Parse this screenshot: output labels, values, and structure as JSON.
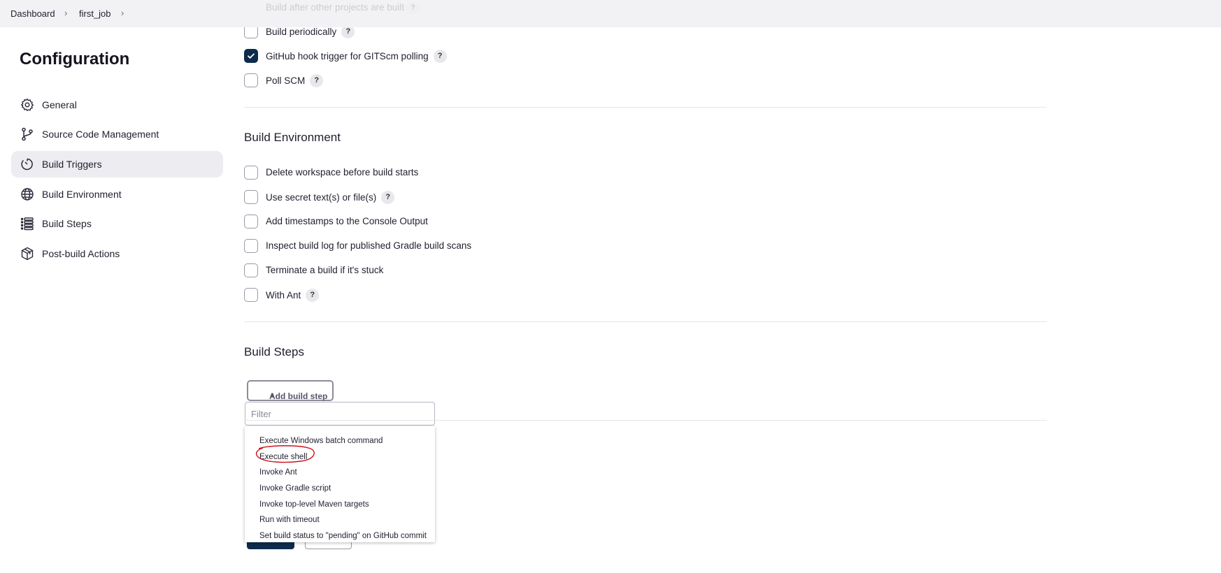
{
  "breadcrumb": {
    "items": [
      "Dashboard",
      "first_job"
    ]
  },
  "sidebar": {
    "title": "Configuration",
    "items": [
      {
        "label": "General",
        "icon": "gear-icon"
      },
      {
        "label": "Source Code Management",
        "icon": "branch-icon"
      },
      {
        "label": "Build Triggers",
        "icon": "timer-icon",
        "active": true
      },
      {
        "label": "Build Environment",
        "icon": "globe-icon"
      },
      {
        "label": "Build Steps",
        "icon": "list-icon"
      },
      {
        "label": "Post-build Actions",
        "icon": "package-icon"
      }
    ]
  },
  "triggers": {
    "faded": "Build after other projects are built",
    "items": [
      {
        "label": "Build periodically",
        "checked": false,
        "help": "?"
      },
      {
        "label": "GitHub hook trigger for GITScm polling",
        "checked": true,
        "help": "?"
      },
      {
        "label": "Poll SCM",
        "checked": false,
        "help": "?"
      }
    ]
  },
  "build_environment": {
    "title": "Build Environment",
    "items": [
      {
        "label": "Delete workspace before build starts",
        "checked": false
      },
      {
        "label": "Use secret text(s) or file(s)",
        "checked": false,
        "help": "?"
      },
      {
        "label": "Add timestamps to the Console Output",
        "checked": false
      },
      {
        "label": "Inspect build log for published Gradle build scans",
        "checked": false
      },
      {
        "label": "Terminate a build if it's stuck",
        "checked": false
      },
      {
        "label": "With Ant",
        "checked": false,
        "help": "?"
      }
    ]
  },
  "build_steps": {
    "title": "Build Steps",
    "add_button": "Add build step",
    "filter_placeholder": "Filter",
    "menu": [
      "Execute Windows batch command",
      "Execute shell",
      "Invoke Ant",
      "Invoke Gradle script",
      "Invoke top-level Maven targets",
      "Run with timeout",
      "Set build status to \"pending\" on GitHub commit"
    ],
    "highlighted_item": "Execute shell"
  },
  "colors": {
    "accent": "#0d2b4d",
    "annotation": "#d0101a",
    "active_bg": "#ececf1"
  }
}
